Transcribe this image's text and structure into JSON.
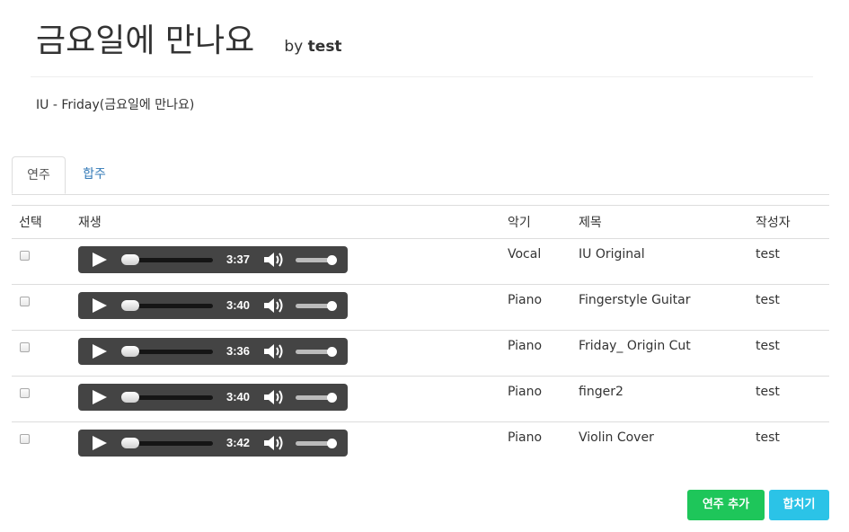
{
  "header": {
    "title": "금요일에 만나요",
    "by_prefix": "by",
    "author": "test"
  },
  "description": "IU - Friday(금요일에 만나요)",
  "tabs": [
    {
      "label": "연주",
      "active": true
    },
    {
      "label": "합주",
      "active": false
    }
  ],
  "table": {
    "headers": {
      "select": "선택",
      "play": "재생",
      "instrument": "악기",
      "title": "제목",
      "author": "작성자"
    },
    "rows": [
      {
        "duration": "3:37",
        "instrument": "Vocal",
        "title": "IU Original",
        "author": "test"
      },
      {
        "duration": "3:40",
        "instrument": "Piano",
        "title": "Fingerstyle Guitar",
        "author": "test"
      },
      {
        "duration": "3:36",
        "instrument": "Piano",
        "title": "Friday_ Origin Cut",
        "author": "test"
      },
      {
        "duration": "3:40",
        "instrument": "Piano",
        "title": "finger2",
        "author": "test"
      },
      {
        "duration": "3:42",
        "instrument": "Piano",
        "title": "Violin Cover",
        "author": "test"
      }
    ]
  },
  "buttons": {
    "add_performance": "연주 추가",
    "merge": "합치기"
  },
  "colors": {
    "link": "#337ab7",
    "add_button": "#1ec65a",
    "merge_button": "#2bc3e7",
    "player_bg": "#444444"
  },
  "icons": {
    "play": "play-icon",
    "volume": "volume-icon"
  }
}
